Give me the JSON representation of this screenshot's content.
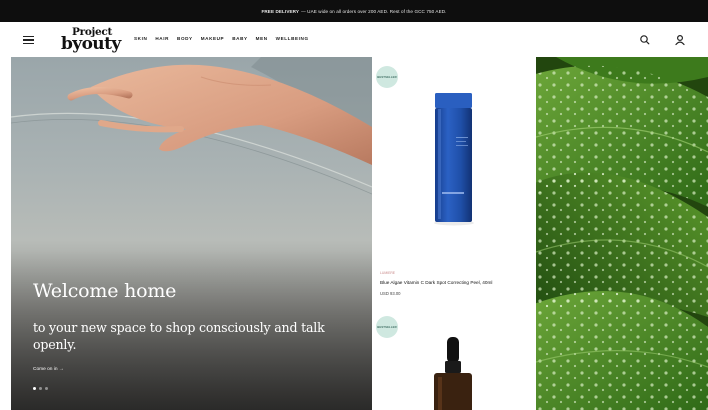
{
  "promo": {
    "bold": "FREE DELIVERY",
    "text": " — UAE wide on all orders over 200 AED. Rest of the GCC 750 AED."
  },
  "brand": {
    "logo_line1": "Project",
    "logo_line2": "byouty"
  },
  "nav": {
    "items": [
      "SKIN",
      "HAIR",
      "BODY",
      "MAKEUP",
      "BABY",
      "MEN",
      "WELLBEING"
    ]
  },
  "header": {
    "search_icon": "search-icon",
    "account_icon": "user-icon",
    "menu_icon": "hamburger-icon"
  },
  "hero": {
    "title": "Welcome home",
    "subtitle": "to your new space to shop consciously and talk openly.",
    "cta": "Come on in →",
    "slides_total": 3,
    "active_slide": 1
  },
  "products": [
    {
      "badge": "Bestseller",
      "brand": "Lumiere",
      "name": "Blue Algae Vitamin C Dark Spot Correcting Peel, 40ml",
      "price": "USD 93.00"
    },
    {
      "badge": "Bestseller"
    }
  ],
  "colors": {
    "promo_bg": "#0e0e0e",
    "badge_bg": "#cfe8e0",
    "bottle_blue": "#1f4fa8",
    "leaf_green": "#3f7a20"
  }
}
